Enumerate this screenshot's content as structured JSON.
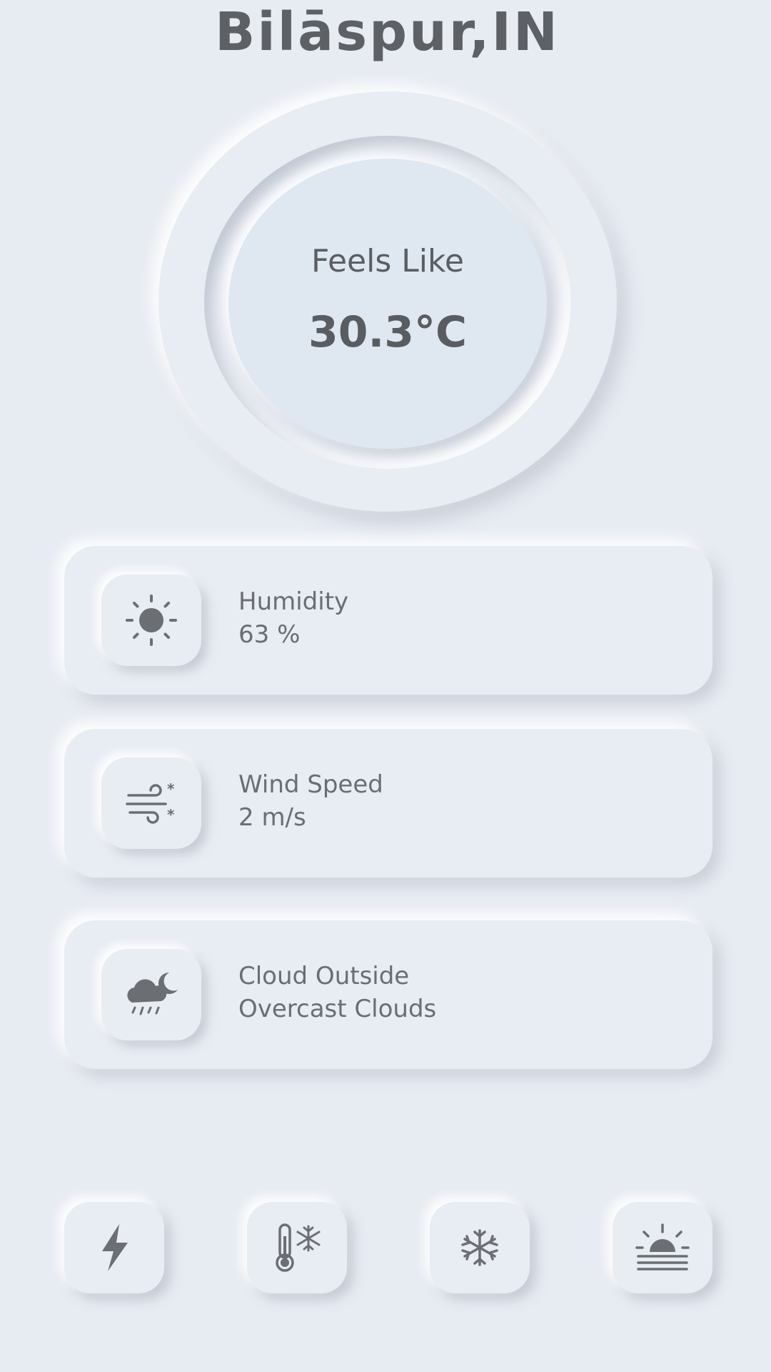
{
  "header": {
    "city": "Bilāspur,IN"
  },
  "feels_like": {
    "label": "Feels Like",
    "value": "30.3°C"
  },
  "cards": [
    {
      "icon": "sun-icon",
      "label": "Humidity",
      "value": "63 %"
    },
    {
      "icon": "wind-icon",
      "label": "Wind Speed",
      "value": "2 m/s"
    },
    {
      "icon": "cloud-moon-rain-icon",
      "label": "Cloud Outside",
      "value": "Overcast Clouds"
    }
  ],
  "bottom_nav": [
    {
      "icon": "lightning-icon"
    },
    {
      "icon": "thermometer-snow-icon"
    },
    {
      "icon": "snowflake-icon"
    },
    {
      "icon": "sunrise-icon"
    }
  ],
  "colors": {
    "background": "#e7ebf2",
    "dial_inner": "#dfe7f0",
    "text": "#555a5f",
    "icon": "#6b6e72"
  }
}
